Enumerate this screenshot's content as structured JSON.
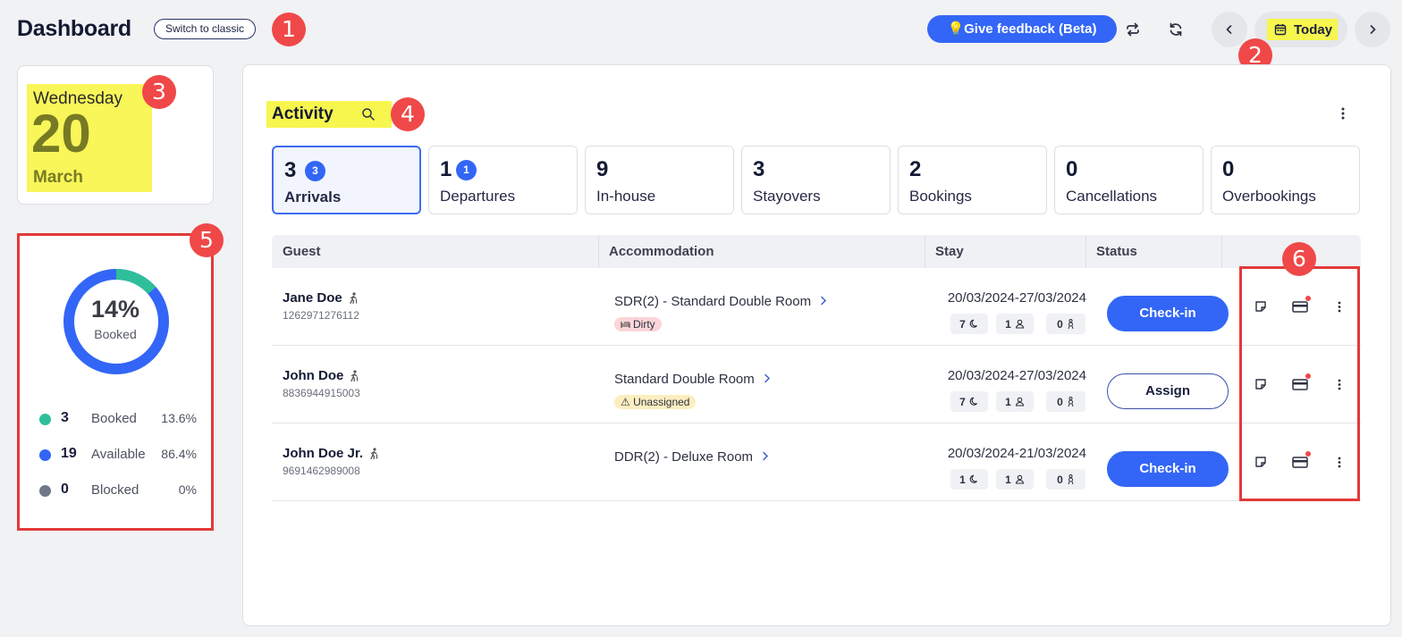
{
  "header": {
    "title": "Dashboard",
    "switch_label": "Switch to classic",
    "feedback_label": "💡Give feedback (Beta)",
    "today_label": "Today",
    "icons": {
      "sync": "sync-icon",
      "refresh": "refresh-icon",
      "prev": "chevron-left-icon",
      "next": "chevron-right-icon",
      "calendar": "calendar-icon"
    }
  },
  "markers": [
    "1",
    "2",
    "3",
    "4",
    "5",
    "6"
  ],
  "date_card": {
    "weekday": "Wednesday",
    "day": "20",
    "month": "March"
  },
  "occupancy": {
    "percent_label": "14%",
    "caption": "Booked",
    "booked_fraction": 0.136,
    "legend": [
      {
        "count": "3",
        "name": "Booked",
        "pct": "13.6%",
        "color": "#2ebf9a"
      },
      {
        "count": "19",
        "name": "Available",
        "pct": "86.4%",
        "color": "#3366f6"
      },
      {
        "count": "0",
        "name": "Blocked",
        "pct": "0%",
        "color": "#707888"
      }
    ]
  },
  "activity": {
    "title": "Activity",
    "stats": [
      {
        "num": "3",
        "badge": "3",
        "label": "Arrivals",
        "active": true
      },
      {
        "num": "1",
        "badge": "1",
        "label": "Departures"
      },
      {
        "num": "9",
        "label": "In-house"
      },
      {
        "num": "3",
        "label": "Stayovers"
      },
      {
        "num": "2",
        "label": "Bookings"
      },
      {
        "num": "0",
        "label": "Cancellations"
      },
      {
        "num": "0",
        "label": "Overbookings"
      }
    ],
    "columns": {
      "guest": "Guest",
      "accommodation": "Accommodation",
      "stay": "Stay",
      "status": "Status"
    },
    "rows": [
      {
        "name": "Jane Doe",
        "id": "1262971276112",
        "room": "SDR(2) - Standard Double Room",
        "tag": "Dirty",
        "tag_type": "dirty",
        "dates": "20/03/2024-27/03/2024",
        "nights": "7",
        "guests": "1",
        "children": "0",
        "action": "Check-in",
        "action_type": "primary"
      },
      {
        "name": "John Doe",
        "id": "8836944915003",
        "room": "Standard Double Room",
        "tag": "⚠ Unassigned",
        "tag_type": "unassigned",
        "dates": "20/03/2024-27/03/2024",
        "nights": "7",
        "guests": "1",
        "children": "0",
        "action": "Assign",
        "action_type": "outline"
      },
      {
        "name": "John Doe Jr.",
        "id": "9691462989008",
        "room": "DDR(2) - Deluxe Room",
        "tag": "",
        "tag_type": "",
        "dates": "20/03/2024-21/03/2024",
        "nights": "1",
        "guests": "1",
        "children": "0",
        "action": "Check-in",
        "action_type": "primary"
      }
    ]
  }
}
